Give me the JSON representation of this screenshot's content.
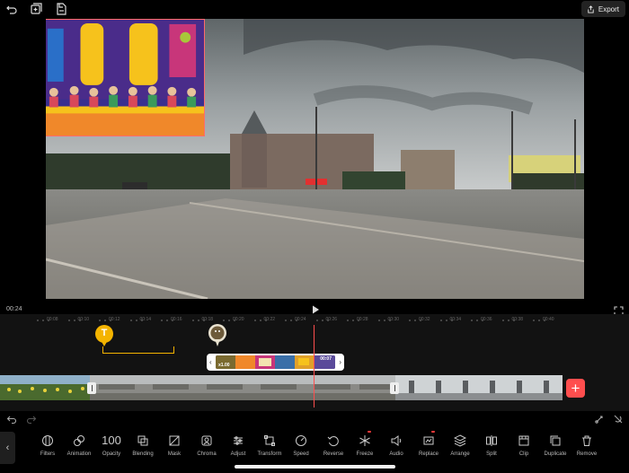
{
  "header": {
    "export_label": "Export"
  },
  "playback": {
    "current_time": "00:24"
  },
  "ruler": {
    "ticks": [
      "00:08",
      "00:10",
      "00:12",
      "00:14",
      "00:16",
      "00:18",
      "00:20",
      "00:22",
      "00:24",
      "00:26",
      "00:28",
      "00:30",
      "00:32",
      "00:34",
      "00:36",
      "00:38",
      "00:40"
    ]
  },
  "overlay_track": {
    "text_marker_glyph": "T",
    "pip_speed": "x1.00",
    "pip_duration": "00:07"
  },
  "add_clip_glyph": "+",
  "toolbar": {
    "items": [
      {
        "label": "Filters",
        "icon": "filters-icon"
      },
      {
        "label": "Animation",
        "icon": "animation-icon"
      },
      {
        "label": "Opacity",
        "value": "100"
      },
      {
        "label": "Blending",
        "icon": "blending-icon"
      },
      {
        "label": "Mask",
        "icon": "mask-icon"
      },
      {
        "label": "Chroma",
        "icon": "chroma-icon"
      },
      {
        "label": "Adjust",
        "icon": "adjust-icon"
      },
      {
        "label": "Transform",
        "icon": "transform-icon"
      },
      {
        "label": "Speed",
        "icon": "speed-icon"
      },
      {
        "label": "Reverse",
        "icon": "reverse-icon"
      },
      {
        "label": "Freeze",
        "icon": "freeze-icon"
      },
      {
        "label": "Audio",
        "icon": "audio-icon"
      },
      {
        "label": "Replace",
        "icon": "replace-icon"
      },
      {
        "label": "Arrange",
        "icon": "arrange-icon"
      },
      {
        "label": "Split",
        "icon": "split-icon"
      },
      {
        "label": "Clip",
        "icon": "clip-icon"
      },
      {
        "label": "Duplicate",
        "icon": "duplicate-icon"
      },
      {
        "label": "Remove",
        "icon": "remove-icon"
      }
    ]
  },
  "colors": {
    "accent": "#ff4e4e",
    "text_marker": "#f4b400"
  }
}
